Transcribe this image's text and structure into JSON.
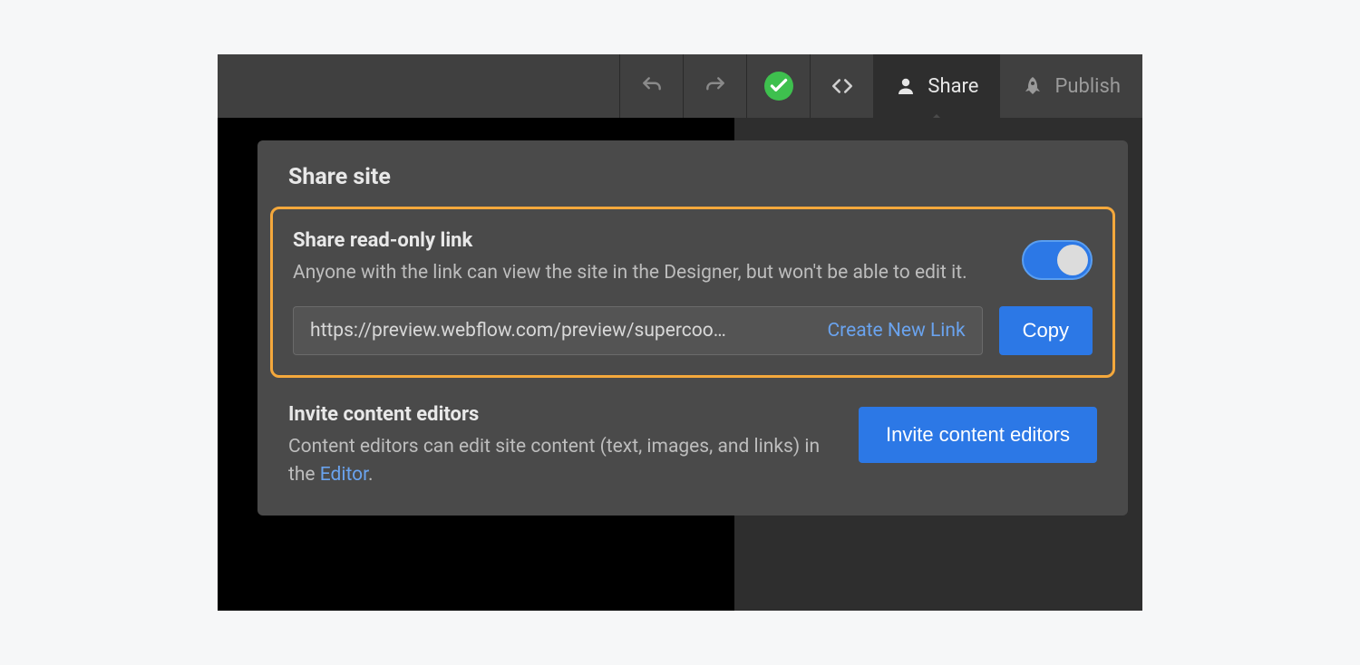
{
  "toolbar": {
    "share_label": "Share",
    "publish_label": "Publish"
  },
  "panel": {
    "title": "Share site",
    "readonly": {
      "heading": "Share read-only link",
      "description": "Anyone with the link can view the site in the Designer, but won't be able to edit it.",
      "url": "https://preview.webflow.com/preview/supercoo…",
      "create_link_label": "Create New Link",
      "copy_label": "Copy",
      "toggle_on": true
    },
    "invite": {
      "heading": "Invite content editors",
      "description_prefix": "Content editors can edit site content (text, images, and links) in the ",
      "editor_link_label": "Editor",
      "description_suffix": ".",
      "button_label": "Invite content editors"
    }
  }
}
